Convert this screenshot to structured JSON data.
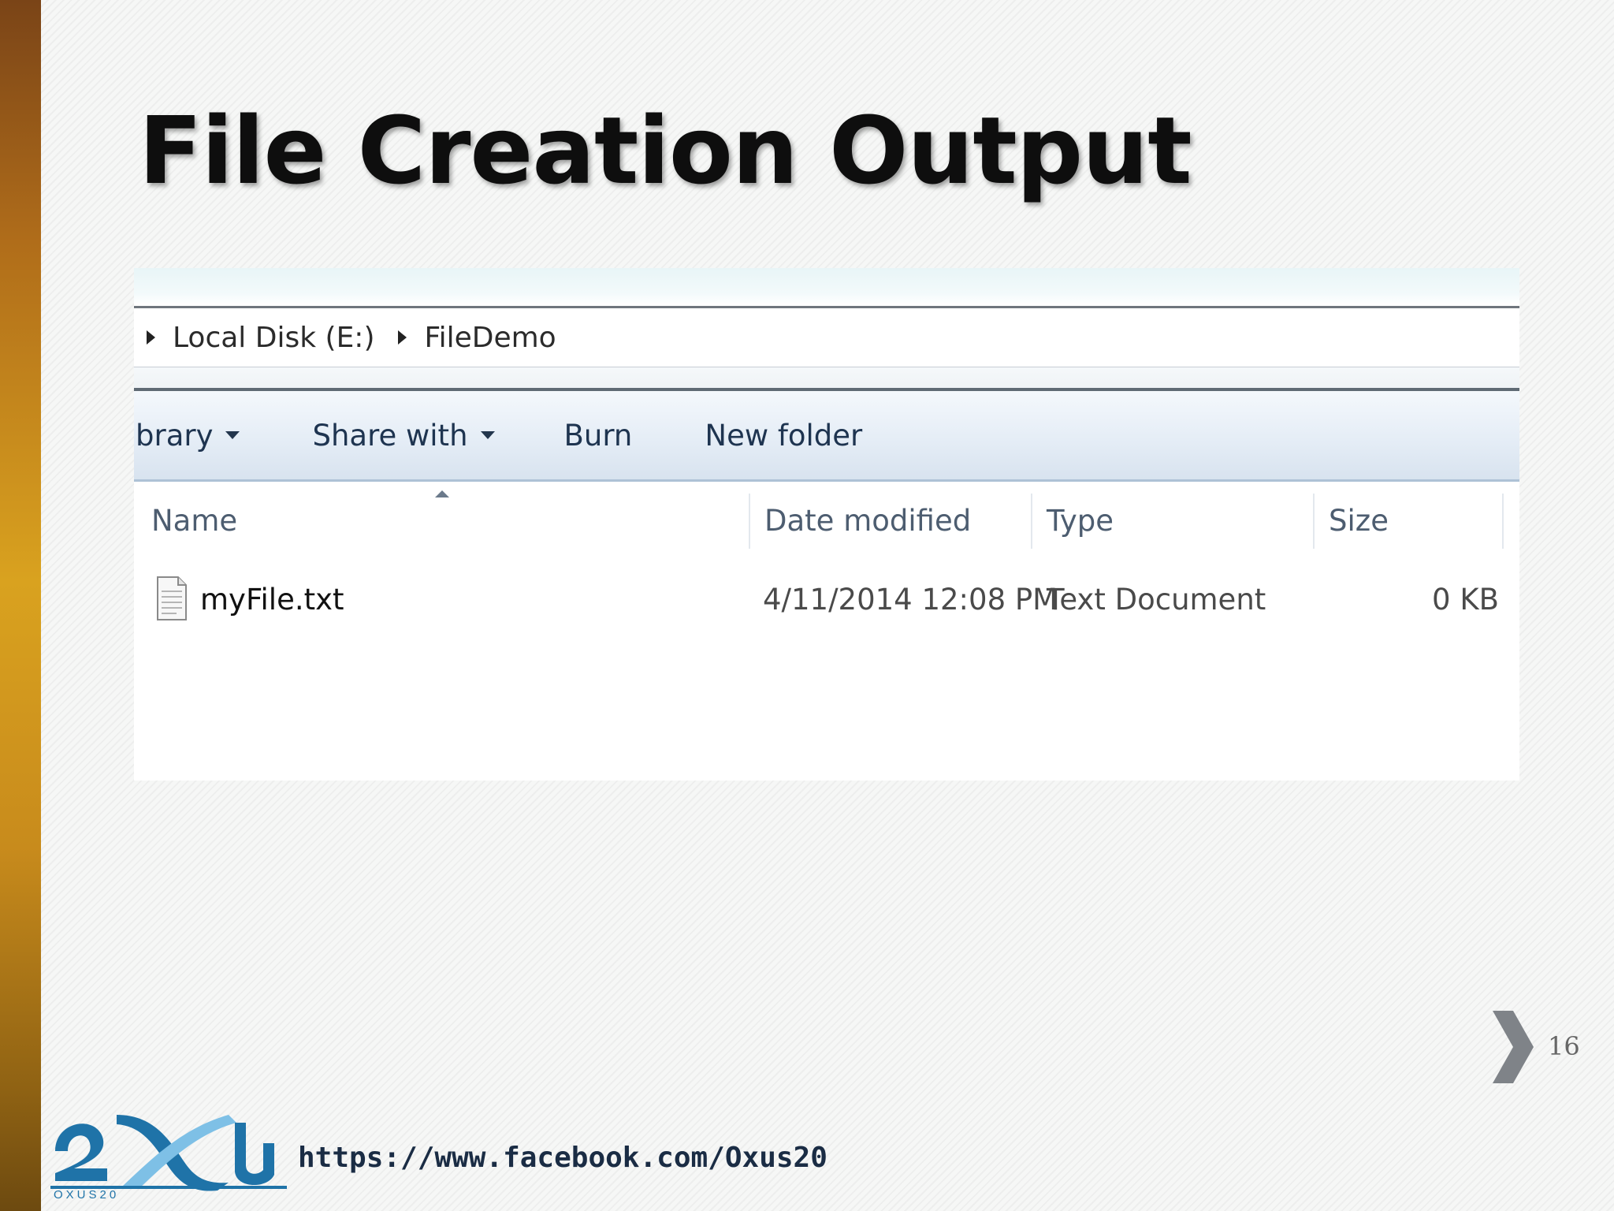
{
  "slide": {
    "title": "File Creation Output",
    "page_number": "16",
    "footer_url": "https://www.facebook.com/Oxus20",
    "logo_text": "OXUS20"
  },
  "explorer": {
    "breadcrumb": [
      "Local Disk (E:)",
      "FileDemo"
    ],
    "toolbar": {
      "library": "brary",
      "share_with": "Share with",
      "burn": "Burn",
      "new_folder": "New folder"
    },
    "columns": {
      "name": "Name",
      "date_modified": "Date modified",
      "type": "Type",
      "size": "Size"
    },
    "files": [
      {
        "name": "myFile.txt",
        "date_modified": "4/11/2014 12:08 PM",
        "type": "Text Document",
        "size": "0 KB"
      }
    ]
  },
  "colors": {
    "accent_bar_top": "#7a4417",
    "accent_bar_mid": "#d9a21f",
    "toolbar_text": "#1e3450",
    "logo_blue": "#1f73a8"
  },
  "icons": [
    "breadcrumb-arrow-icon",
    "dropdown-caret-icon",
    "sort-ascending-icon",
    "text-document-icon",
    "next-slide-chevron-icon",
    "oxus20-logo"
  ]
}
